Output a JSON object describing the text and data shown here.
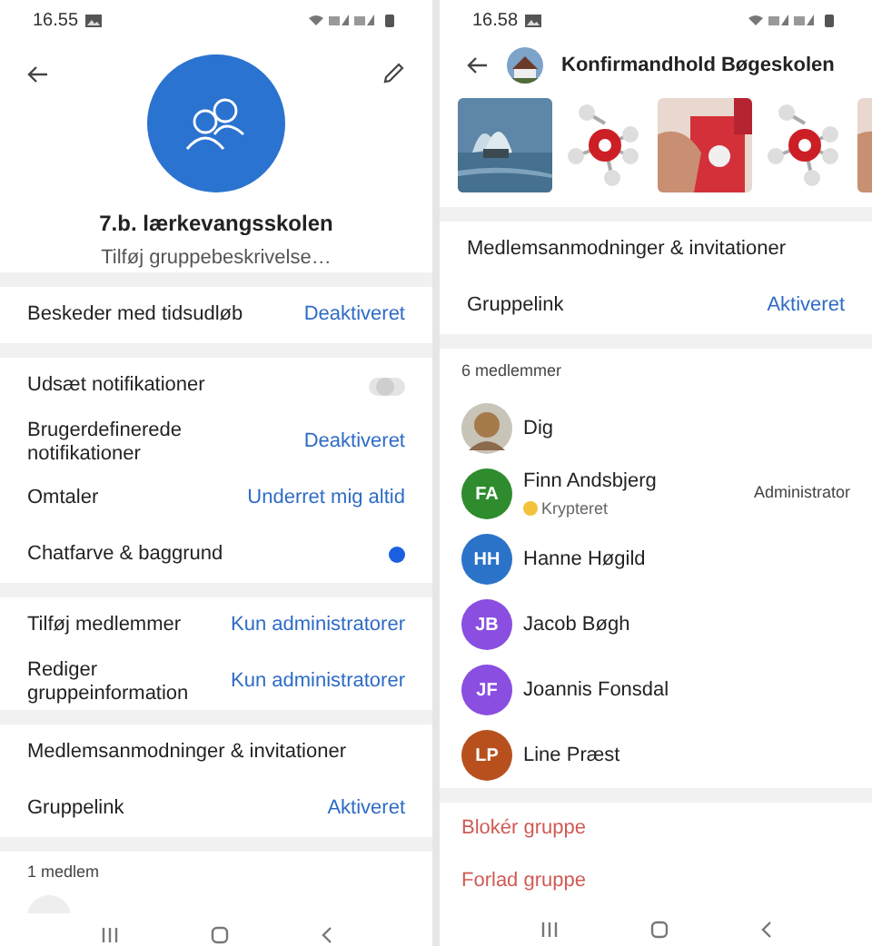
{
  "group_settings": {
    "status_bar": {
      "time": "16.55"
    },
    "header": {
      "title": "7.b. lærkevangsskolen",
      "subtitle": "Tilføj gruppebeskrivelse…"
    },
    "sections": [
      [
        {
          "kind": "value",
          "label": "Beskeder med tidsudløb",
          "value": "Deaktiveret"
        }
      ],
      [
        {
          "kind": "toggle",
          "label": "Udsæt notifikationer",
          "on": false
        },
        {
          "kind": "value",
          "label": "Brugerdefinerede notifikationer",
          "value": "Deaktiveret"
        },
        {
          "kind": "value",
          "label": "Omtaler",
          "value": "Underret mig altid"
        },
        {
          "kind": "color",
          "label": "Chatfarve & baggrund",
          "color": "#1a5fe0"
        }
      ],
      [
        {
          "kind": "value",
          "label": "Tilføj medlemmer",
          "value": "Kun administratorer"
        },
        {
          "kind": "value",
          "label": "Rediger gruppeinformation",
          "value": "Kun administratorer"
        }
      ],
      [
        {
          "kind": "link",
          "label": "Medlemsanmodninger & invitationer"
        },
        {
          "kind": "value",
          "label": "Gruppelink",
          "value": "Aktiveret"
        }
      ]
    ],
    "members_heading": "1 medlem"
  },
  "group_details": {
    "status_bar": {
      "time": "16.58"
    },
    "header": {
      "title": "Konfirmandhold Bøgeskolen"
    },
    "sections": [
      [
        {
          "kind": "link",
          "label": "Medlemsanmodninger & invitationer"
        },
        {
          "kind": "value",
          "label": "Gruppelink",
          "value": "Aktiveret"
        }
      ]
    ],
    "members_heading": "6 medlemmer",
    "members": [
      {
        "name": "Dig"
      },
      {
        "name": "Finn Andsbjerg",
        "initials": "FA",
        "color": "#2e8b2e",
        "status": "Krypteret",
        "role": "Administrator"
      },
      {
        "name": "Hanne Høgild",
        "initials": "HH",
        "color": "#2b73c8"
      },
      {
        "name": "Jacob Bøgh",
        "initials": "JB",
        "color": "#8a4ee0"
      },
      {
        "name": "Joannis Fonsdal",
        "initials": "JF",
        "color": "#8a4ee0"
      },
      {
        "name": "Line Præst",
        "initials": "LP",
        "color": "#b8501e"
      }
    ],
    "actions": [
      "Blokér gruppe",
      "Forlad gruppe"
    ]
  }
}
